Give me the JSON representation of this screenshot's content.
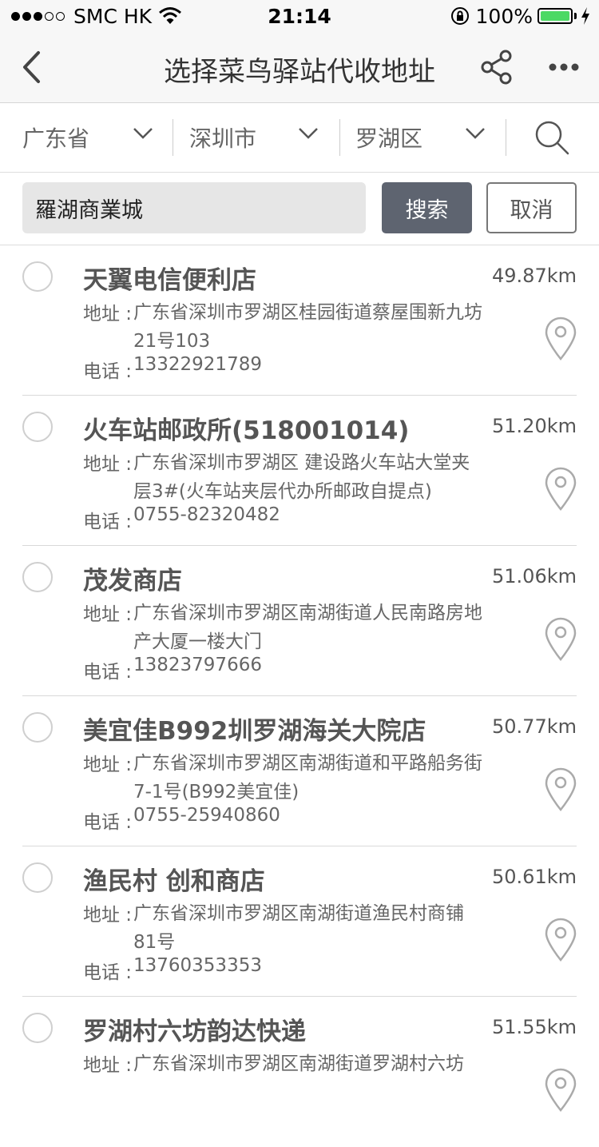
{
  "status_bar": {
    "carrier": "SMC HK",
    "time": "21:14",
    "battery": "100%"
  },
  "nav": {
    "title": "选择菜鸟驿站代收地址"
  },
  "filters": {
    "province": "广东省",
    "city": "深圳市",
    "district": "罗湖区"
  },
  "search": {
    "value": "羅湖商業城",
    "search_label": "搜索",
    "cancel_label": "取消"
  },
  "labels": {
    "address": "地址 :",
    "phone": "电话 :"
  },
  "stations": [
    {
      "name": "天翼电信便利店",
      "distance": "49.87km",
      "address": "广东省深圳市罗湖区桂园街道蔡屋围新九坊21号103",
      "phone": "13322921789"
    },
    {
      "name": "火车站邮政所(518001014)",
      "distance": "51.20km",
      "address": "广东省深圳市罗湖区 建设路火车站大堂夹层3#(火车站夹层代办所邮政自提点)",
      "phone": "0755-82320482"
    },
    {
      "name": "茂发商店",
      "distance": "51.06km",
      "address": "广东省深圳市罗湖区南湖街道人民南路房地产大厦一楼大门",
      "phone": "13823797666"
    },
    {
      "name": "美宜佳B992圳罗湖海关大院店",
      "distance": "50.77km",
      "address": "广东省深圳市罗湖区南湖街道和平路船务街7-1号(B992美宜佳)",
      "phone": "0755-25940860"
    },
    {
      "name": "渔民村 创和商店",
      "distance": "50.61km",
      "address": "广东省深圳市罗湖区南湖街道渔民村商铺81号",
      "phone": "13760353353"
    },
    {
      "name": "罗湖村六坊韵达快递",
      "distance": "51.55km",
      "address": "广东省深圳市罗湖区南湖街道罗湖村六坊",
      "phone": ""
    }
  ]
}
